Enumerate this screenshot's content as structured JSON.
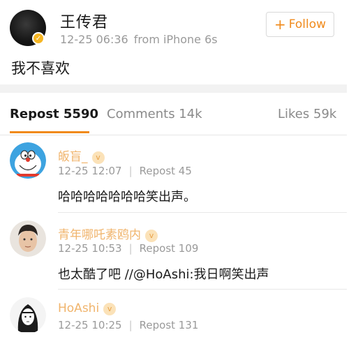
{
  "post": {
    "author": "王传君",
    "time": "12-25 06:36",
    "source": "from iPhone 6s",
    "text": "我不喜欢",
    "follow_label": "Follow",
    "follow_icon": "plus-icon"
  },
  "tabs": [
    {
      "label": "Repost 5590",
      "active": true
    },
    {
      "label": "Comments 14k",
      "active": false
    },
    {
      "label": "Likes 59k",
      "active": false
    }
  ],
  "reposts": [
    {
      "name": "皈盲_",
      "time": "12-25 12:07",
      "reposts": "Repost 45",
      "text": "哈哈哈哈哈哈哈笑出声。",
      "avatar": "doraemon-avatar"
    },
    {
      "name": "青年哪吒素鸥内",
      "time": "12-25 10:53",
      "reposts": "Repost 109",
      "text": "也太酷了吧 //@HoAshi:我日啊笑出声",
      "avatar": "man-portrait-avatar"
    },
    {
      "name": "HoAshi",
      "time": "12-25 10:25",
      "reposts": "Repost 131",
      "text": "",
      "avatar": "drawn-girl-avatar"
    }
  ],
  "colors": {
    "accent": "#f08a1b",
    "vip_name": "#f0b46c",
    "muted": "#9a9a9a"
  }
}
